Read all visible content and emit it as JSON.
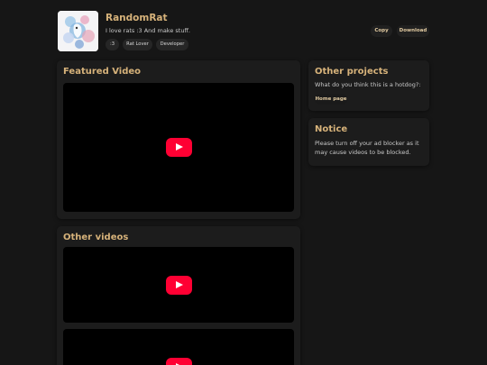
{
  "profile": {
    "name": "RandomRat",
    "bio": "I love rats :3 And make stuff.",
    "tags": [
      ":3",
      "Rat Lover",
      "Developer"
    ]
  },
  "header_actions": {
    "copy_label": "Copy",
    "download_label": "Download"
  },
  "featured": {
    "title": "Featured Video"
  },
  "other_videos": {
    "title": "Other videos"
  },
  "other_projects": {
    "title": "Other projects",
    "text": "What do you think this is a hotdog?:",
    "button_label": "Home page"
  },
  "notice": {
    "title": "Notice",
    "text": "Please turn off your ad blocker as it may cause videos to be blocked."
  },
  "colors": {
    "accent": "#d6b27a",
    "play": "#ff0033",
    "background": "#161616",
    "card": "#1c1c1c"
  }
}
